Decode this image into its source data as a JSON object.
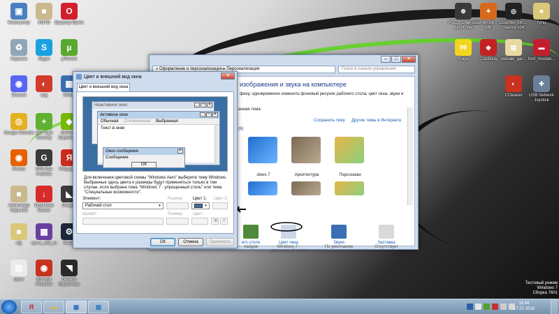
{
  "desktop_icons_left": [
    {
      "label": "Компьютер",
      "color": "#4a7fc1",
      "glyph": "▣",
      "icon": "computer-icon"
    },
    {
      "label": "ФОТО",
      "color": "#c9b98c",
      "glyph": "■",
      "icon": "photo-folder-icon"
    },
    {
      "label": "Браузер Opera",
      "color": "#d21f2b",
      "glyph": "O",
      "icon": "opera-icon"
    },
    {
      "label": "Корзина",
      "color": "#8fa6b8",
      "glyph": "♻",
      "icon": "recycle-bin-icon"
    },
    {
      "label": "Skype",
      "color": "#1aa1e0",
      "glyph": "S",
      "icon": "skype-icon"
    },
    {
      "label": "µTorrent",
      "color": "#58a92e",
      "glyph": "µ",
      "icon": "utorrent-icon"
    },
    {
      "label": "Discord",
      "color": "#5865f2",
      "glyph": "◉",
      "icon": "discord-icon"
    },
    {
      "label": "код",
      "color": "#d23a2a",
      "glyph": "◐",
      "icon": "code-icon"
    },
    {
      "label": "Windo",
      "color": "#3c6fb1",
      "glyph": "▦",
      "icon": "windows-icon"
    },
    {
      "label": "Google Chrome",
      "color": "#e3b021",
      "glyph": "◎",
      "icon": "chrome-icon"
    },
    {
      "label": "360 Total Security",
      "color": "#5fb12f",
      "glyph": "+",
      "icon": "360-security-icon"
    },
    {
      "label": "GeForce Experience",
      "color": "#76b900",
      "glyph": "◆",
      "icon": "geforce-icon"
    },
    {
      "label": "Firefox",
      "color": "#e66000",
      "glyph": "◉",
      "icon": "firefox-icon"
    },
    {
      "label": "GTA San Andreas",
      "color": "#3a3a3a",
      "glyph": "G",
      "icon": "gta-icon"
    },
    {
      "label": "Я.Браузер",
      "color": "#cc2b1d",
      "glyph": "Я",
      "icon": "yandex-browser-icon"
    },
    {
      "label": "Александр Нарыков",
      "color": "#c9b98c",
      "glyph": "■",
      "icon": "user-folder-icon"
    },
    {
      "label": "Download Master",
      "color": "#d72b2b",
      "glyph": "↓",
      "icon": "download-master-icon"
    },
    {
      "label": "Dragon",
      "color": "#3a3a3a",
      "glyph": "◣",
      "icon": "dragon-icon"
    },
    {
      "label": "cfg",
      "color": "#d9c77a",
      "glyph": "■",
      "icon": "cfg-folder-icon"
    },
    {
      "label": "cpu-z_x64_ru",
      "color": "#6b3fa0",
      "glyph": "▩",
      "icon": "cpuz-icon"
    },
    {
      "label": "Steam",
      "color": "#1b2838",
      "glyph": "⚙",
      "icon": "steam-icon"
    },
    {
      "label": "cpu.c",
      "color": "#eaeaea",
      "glyph": "▤",
      "icon": "file-icon"
    },
    {
      "label": "Burnout Paradise",
      "color": "#c8321e",
      "glyph": "◉",
      "icon": "burnout-icon"
    },
    {
      "label": "Generic Experience",
      "color": "#2a2a2a",
      "glyph": "◥",
      "icon": "generic-icon"
    }
  ],
  "desktop_icons_right": [
    {
      "label": "PGCS Changed Aim!Know",
      "color": "#3a3a3a",
      "glyph": "⊕",
      "icon": "pgcs-icon"
    },
    {
      "label": "Counter-Str... 1.6 Mir",
      "color": "#d76a1a",
      "glyph": "✦",
      "icon": "cs16-icon"
    },
    {
      "label": "Counter-Stri... Source v34",
      "color": "#222",
      "glyph": "◎",
      "icon": "css-icon"
    },
    {
      "label": "гуты",
      "color": "#d9c77a",
      "glyph": "■",
      "icon": "guty-folder-icon"
    },
    {
      "label": "Fraps",
      "color": "#f2d61d",
      "glyph": "99",
      "icon": "fraps-icon"
    },
    {
      "label": "Crashday",
      "color": "#c22222",
      "glyph": "◆",
      "icon": "crashday-icon"
    },
    {
      "label": "redsale_gar...",
      "color": "#e8d9a2",
      "glyph": "▤",
      "icon": "redsale-icon"
    },
    {
      "label": "ford_mustan...",
      "color": "#c21f2e",
      "glyph": "▬",
      "icon": "ford-icon"
    },
    {
      "label": "CCleaner",
      "color": "#c8321e",
      "glyph": "◐",
      "icon": "ccleaner-icon"
    },
    {
      "label": "USB Network Joystick",
      "color": "#6b7f99",
      "glyph": "✚",
      "icon": "usb-joystick-icon"
    }
  ],
  "personalization": {
    "title": "",
    "path": "« Оформление и персонализация ▸ Персонализация",
    "search_placeholder": "Поиск в панели управления",
    "heading": "изображения и звука на компьютере",
    "subheading": "фону, одновременно изменить фоновый рисунок рабочего стола, цвет окна, звуки и",
    "saved_theme": "анная тема",
    "save_theme_link": "Сохранить тему",
    "more_themes_link": "Другие темы в Интернете",
    "aero_count": "(6)",
    "themes": [
      {
        "label": "dows 7",
        "c1": "#1e6fd0",
        "c2": "#6fb3ff"
      },
      {
        "label": "Архитектура",
        "c1": "#7a6a55",
        "c2": "#b9a98f"
      },
      {
        "label": "Персонажи",
        "c1": "#e6b54a",
        "c2": "#8ccf7d"
      }
    ],
    "bottom": [
      {
        "label": "его стола",
        "sub": "лайдов",
        "icon": "desktop-bg-icon"
      },
      {
        "label": "Цвет окна",
        "sub": "Windows 7 - упрощенный стиль",
        "icon": "window-color-icon"
      },
      {
        "label": "Звуки",
        "sub": "По умолчанию",
        "icon": "sounds-icon"
      },
      {
        "label": "Заставка",
        "sub": "Отсутствует",
        "icon": "screensaver-icon"
      }
    ]
  },
  "color_window": {
    "title": "Цвет и внешний вид окна",
    "tab": "Цвет и внешний вид окна",
    "inactive_title": "Неактивное окно",
    "active_title": "Активное окно",
    "menu_normal": "Обычная",
    "menu_disabled": "Отключенная",
    "menu_selected": "Выбранная",
    "window_text": "Текст в окне",
    "msgbox_title": "Окно сообщения",
    "msgbox_text": "Сообщение",
    "msgbox_ok": "ОК",
    "description": "Для включения цветовой схемы \"Windows Aero\" выберите тему Windows. Выбранные здесь цвета и размеры будут применяться только в том случае, если выбрана тема \"Windows 7 - упрощенный стиль\" или тема \"Специальные возможности\".",
    "element_label": "Элемент:",
    "element_value": "Рабочий стол",
    "size_label": "Размер:",
    "color1_label": "Цвет 1:",
    "color2_label": "Цвет 2:",
    "font_label": "Шрифт:",
    "font_size_label": "Размер:",
    "font_color_label": "Цвет:",
    "bold_label": "Ж",
    "italic_label": "К",
    "ok": "ОК",
    "cancel": "Отмена",
    "apply": "Применить"
  },
  "taskbar": {
    "time": "11:44",
    "date": "17.07.2018",
    "language": "RU"
  },
  "watermark": {
    "line1": "Тестовый режим",
    "line2": "Windows 7",
    "line3": "Сборка 7601"
  }
}
